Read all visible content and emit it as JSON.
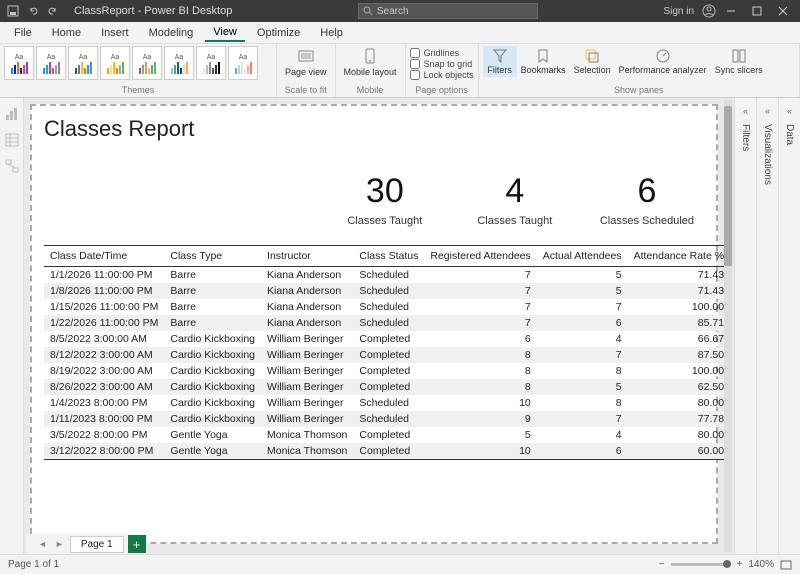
{
  "titlebar": {
    "title": "ClassReport - Power BI Desktop",
    "search_placeholder": "Search",
    "sign_in": "Sign in"
  },
  "menu": {
    "file": "File",
    "home": "Home",
    "insert": "Insert",
    "modeling": "Modeling",
    "view": "View",
    "optimize": "Optimize",
    "help": "Help"
  },
  "ribbon": {
    "themes_label": "Themes",
    "scale_label": "Scale to fit",
    "mobile_label": "Mobile",
    "pageopt_label": "Page options",
    "showpanes_label": "Show panes",
    "page_view": "Page view",
    "mobile_layout": "Mobile layout",
    "gridlines": "Gridlines",
    "snap": "Snap to grid",
    "lock": "Lock objects",
    "filters": "Filters",
    "bookmarks": "Bookmarks",
    "selection": "Selection",
    "perf": "Performance analyzer",
    "sync": "Sync slicers"
  },
  "panes": {
    "filters": "Filters",
    "viz": "Visualizations",
    "data": "Data"
  },
  "report": {
    "title": "Classes Report",
    "kpis": [
      {
        "value": "30",
        "label": "Classes Taught"
      },
      {
        "value": "4",
        "label": "Classes Taught"
      },
      {
        "value": "6",
        "label": "Classes Scheduled"
      }
    ],
    "columns": [
      "Class Date/Time",
      "Class Type",
      "Instructor",
      "Class Status",
      "Registered Attendees",
      "Actual Attendees",
      "Attendance Rate %"
    ],
    "rows": [
      [
        "1/1/2026 11:00:00 PM",
        "Barre",
        "Kiana Anderson",
        "Scheduled",
        "7",
        "5",
        "71.43"
      ],
      [
        "1/8/2026 11:00:00 PM",
        "Barre",
        "Kiana Anderson",
        "Scheduled",
        "7",
        "5",
        "71.43"
      ],
      [
        "1/15/2026 11:00:00 PM",
        "Barre",
        "Kiana Anderson",
        "Scheduled",
        "7",
        "7",
        "100.00"
      ],
      [
        "1/22/2026 11:00:00 PM",
        "Barre",
        "Kiana Anderson",
        "Scheduled",
        "7",
        "6",
        "85.71"
      ],
      [
        "8/5/2022 3:00:00 AM",
        "Cardio Kickboxing",
        "William Beringer",
        "Completed",
        "6",
        "4",
        "66.67"
      ],
      [
        "8/12/2022 3:00:00 AM",
        "Cardio Kickboxing",
        "William Beringer",
        "Completed",
        "8",
        "7",
        "87.50"
      ],
      [
        "8/19/2022 3:00:00 AM",
        "Cardio Kickboxing",
        "William Beringer",
        "Completed",
        "8",
        "8",
        "100.00"
      ],
      [
        "8/26/2022 3:00:00 AM",
        "Cardio Kickboxing",
        "William Beringer",
        "Completed",
        "8",
        "5",
        "62.50"
      ],
      [
        "1/4/2023 8:00:00 PM",
        "Cardio Kickboxing",
        "William Beringer",
        "Scheduled",
        "10",
        "8",
        "80.00"
      ],
      [
        "1/11/2023 8:00:00 PM",
        "Cardio Kickboxing",
        "William Beringer",
        "Scheduled",
        "9",
        "7",
        "77.78"
      ],
      [
        "3/5/2022 8:00:00 PM",
        "Gentle Yoga",
        "Monica Thomson",
        "Completed",
        "5",
        "4",
        "80.00"
      ],
      [
        "3/12/2022 8:00:00 PM",
        "Gentle Yoga",
        "Monica Thomson",
        "Completed",
        "10",
        "6",
        "60.00"
      ]
    ]
  },
  "pagetabs": {
    "page1": "Page 1"
  },
  "status": {
    "page_of": "Page 1 of 1",
    "zoom": "140%"
  },
  "theme_colors": [
    [
      "#118DFF",
      "#12239E",
      "#E66C37",
      "#6B007B",
      "#E044A7",
      "#744EC2"
    ],
    [
      "#499195",
      "#00ACFC",
      "#C83D95",
      "#9C6A6A",
      "#AE9C85",
      "#8D6FD1"
    ],
    [
      "#107C10",
      "#8764B8",
      "#F2C811",
      "#EF6950",
      "#00B7C3",
      "#8D6FD1"
    ],
    [
      "#FFA500",
      "#FFE399",
      "#FFC000",
      "#ED7D31",
      "#A5A5A5",
      "#70AD47"
    ],
    [
      "#4472C4",
      "#ED7D31",
      "#A5A5A5",
      "#FFC000",
      "#5B9BD5",
      "#70AD47"
    ],
    [
      "#8EC7D2",
      "#4A9FB0",
      "#1E5F74",
      "#133B5C",
      "#FCDAB7",
      "#FFA45B"
    ],
    [
      "#E8E8E8",
      "#BEBEBE",
      "#888888",
      "#555555",
      "#2E2E2E",
      "#000000"
    ],
    [
      "#70A8B5",
      "#B5D5DC",
      "#D9E6F2",
      "#FCE2C4",
      "#F5B48A",
      "#E9856B"
    ]
  ]
}
